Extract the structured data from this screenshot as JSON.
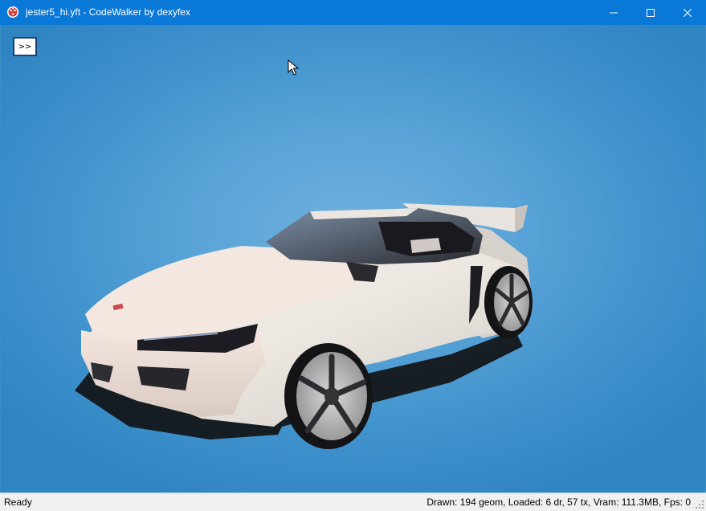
{
  "window": {
    "title": "jester5_hi.yft - CodeWalker by dexyfex",
    "icon": "codewalker-app-icon",
    "titlebar_color": "#0a78d6"
  },
  "viewport": {
    "toggle_label": ">>",
    "background_color": "#3a8fc8",
    "model_icon": "sports-car-3d-model"
  },
  "statusbar": {
    "status": "Ready",
    "stats": "Drawn: 194 geom, Loaded: 6 dr, 57 tx, Vram: 111.3MB, Fps: 0"
  }
}
